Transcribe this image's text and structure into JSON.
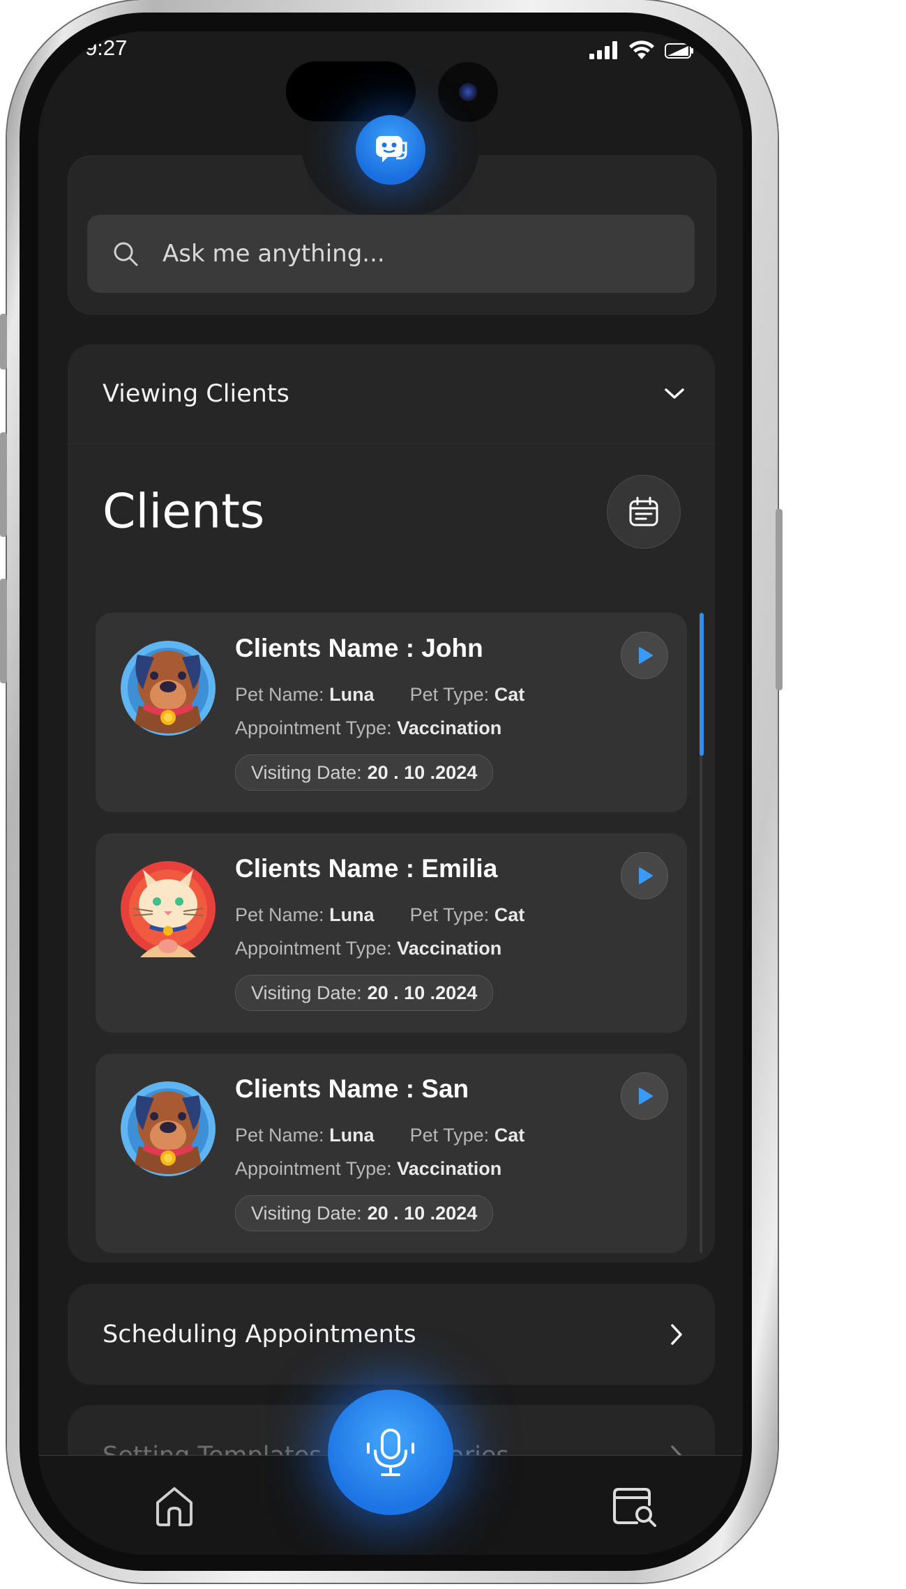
{
  "status_bar": {
    "time": "9:27"
  },
  "search": {
    "placeholder": "Ask me anything..."
  },
  "viewing_section": {
    "label": "Viewing Clients"
  },
  "clients": {
    "title": "Clients",
    "labels": {
      "pet_name": "Pet Name:",
      "pet_type": "Pet Type:",
      "appointment_type": "Appointment Type:",
      "visiting_date": "Visiting Date:"
    },
    "items": [
      {
        "name": "Clients Name : John",
        "pet_name": "Luna",
        "pet_type": "Cat",
        "appointment_type": "Vaccination",
        "visiting_date": "20 . 10 .2024",
        "avatar": "dog-avatar"
      },
      {
        "name": "Clients Name : Emilia",
        "pet_name": "Luna",
        "pet_type": "Cat",
        "appointment_type": "Vaccination",
        "visiting_date": "20 . 10 .2024",
        "avatar": "cat-avatar"
      },
      {
        "name": "Clients Name : San",
        "pet_name": "Luna",
        "pet_type": "Cat",
        "appointment_type": "Vaccination",
        "visiting_date": "20 . 10 .2024",
        "avatar": "dog-avatar"
      }
    ]
  },
  "menu_sections": [
    {
      "label": "Scheduling Appointments"
    },
    {
      "label": "Setting Templates for Summaries"
    }
  ],
  "bottom_nav": {
    "home_icon": "home-icon",
    "mic_icon": "microphone-icon",
    "history_icon": "calendar-search-icon"
  },
  "colors": {
    "accent": "#2f8ef5",
    "background": "#1b1b1b",
    "card": "#262626",
    "item": "#333333"
  }
}
